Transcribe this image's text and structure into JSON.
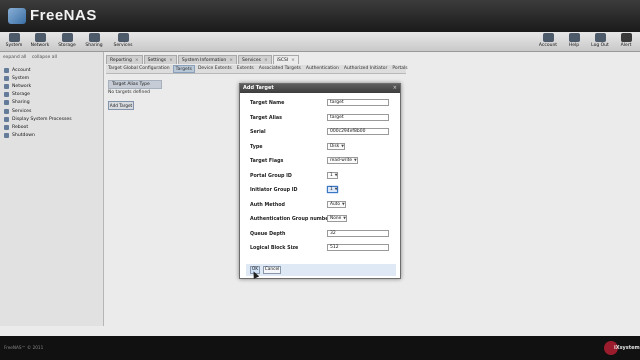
{
  "app": {
    "title": "FreeNAS"
  },
  "toolbar": {
    "left": [
      {
        "label": "System",
        "icon": "system-icon"
      },
      {
        "label": "Network",
        "icon": "network-icon"
      },
      {
        "label": "Storage",
        "icon": "storage-icon"
      },
      {
        "label": "Sharing",
        "icon": "sharing-icon"
      },
      {
        "label": "Services",
        "icon": "services-icon"
      }
    ],
    "right": [
      {
        "label": "Account",
        "icon": "account-icon"
      },
      {
        "label": "Help",
        "icon": "help-icon"
      },
      {
        "label": "Log Out",
        "icon": "logout-icon"
      },
      {
        "label": "Alert",
        "icon": "alert-icon"
      }
    ]
  },
  "sidebar": {
    "expand_all": "expand all",
    "collapse_all": "collapse all",
    "items": [
      {
        "label": "Account",
        "sub": false
      },
      {
        "label": "System",
        "sub": false
      },
      {
        "label": "Network",
        "sub": false
      },
      {
        "label": "Storage",
        "sub": false
      },
      {
        "label": "Sharing",
        "sub": false
      },
      {
        "label": "Services",
        "sub": false
      },
      {
        "label": "Display System Processes",
        "sub": false
      },
      {
        "label": "Reboot",
        "sub": false
      },
      {
        "label": "Shutdown",
        "sub": false
      }
    ]
  },
  "tabs": [
    "Reporting",
    "Settings",
    "System Information",
    "Services",
    "iSCSI"
  ],
  "subtabs": [
    "Target Global Configuration",
    "Targets",
    "Device Extents",
    "Extents",
    "Associated Targets",
    "Authentication",
    "Authorized Initiator",
    "Portals"
  ],
  "targets_panel": {
    "column_header": "Target  Alias  Type",
    "empty_text": "No targets defined",
    "add_button": "Add Target"
  },
  "dialog": {
    "title": "Add Target",
    "close": "×",
    "fields": [
      {
        "label": "Target Name",
        "kind": "input",
        "value": "target"
      },
      {
        "label": "Target Alias",
        "kind": "input",
        "value": "target"
      },
      {
        "label": "Serial",
        "kind": "input",
        "value": "000c294ef8b00"
      },
      {
        "label": "Type",
        "kind": "select",
        "value": "Disk"
      },
      {
        "label": "Target Flags",
        "kind": "select",
        "value": "read-write"
      },
      {
        "label": "Portal Group ID",
        "kind": "select",
        "value": "1"
      },
      {
        "label": "Initiator Group ID",
        "kind": "select",
        "value": "1",
        "focused": true
      },
      {
        "label": "Auth Method",
        "kind": "select",
        "value": "Auto"
      },
      {
        "label": "Authentication Group number",
        "kind": "select",
        "value": "None"
      },
      {
        "label": "Queue Depth",
        "kind": "input",
        "value": "32"
      },
      {
        "label": "Logical Block Size",
        "kind": "input",
        "value": "512"
      }
    ],
    "ok_label": "OK",
    "cancel_label": "Cancel"
  },
  "footer": {
    "copyright": "FreeNAS™ © 2011",
    "brand": "iXsystems"
  }
}
